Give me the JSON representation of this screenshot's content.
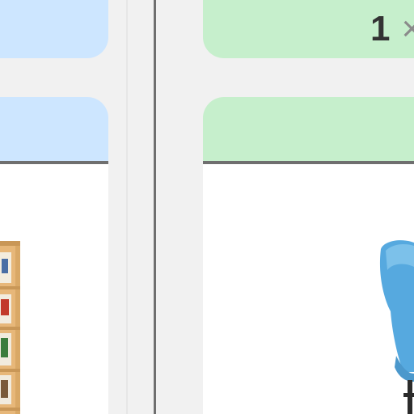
{
  "comparison": {
    "right_item": {
      "quantity": "1",
      "multiplier": "×"
    }
  },
  "colors": {
    "left_card_bg": "#cde6ff",
    "right_card_bg": "#c6efcc",
    "background": "#f1f1f1",
    "divider": "#6f6f6f"
  },
  "icons": [
    "bookshelf-image",
    "chair-image"
  ]
}
